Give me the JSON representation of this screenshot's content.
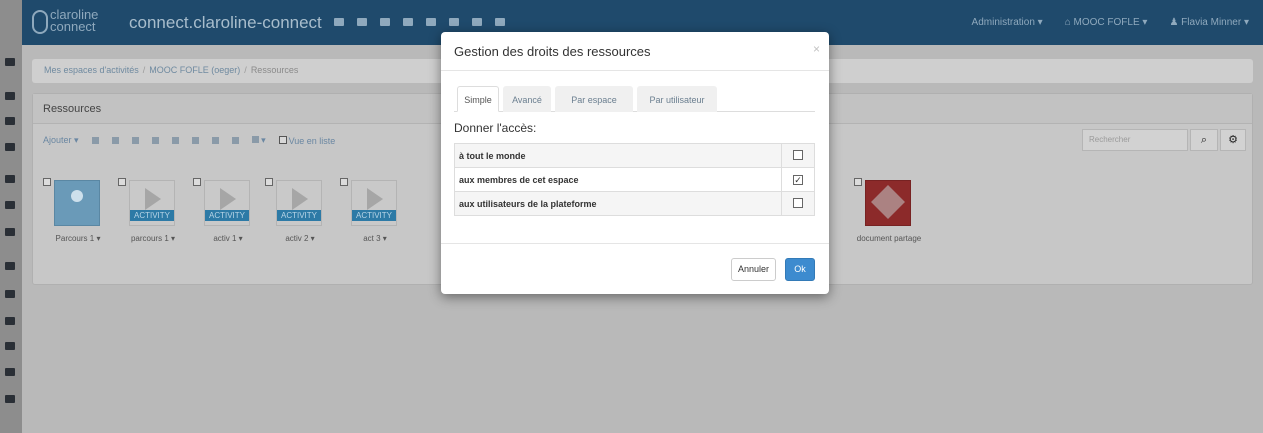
{
  "navbar": {
    "logo_line1": "claroline",
    "logo_line2": "connect",
    "workspace_title": "connect.claroline-connect",
    "admin_menu": "Administration ▾",
    "workspace_menu": "⌂ MOOC FOFLE ▾",
    "user_menu": "♟ Flavia Minner ▾"
  },
  "breadcrumb": {
    "home": "Mes espaces d'activités",
    "workspace": "MOOC FOFLE (oeger)",
    "current": "Ressources"
  },
  "panel": {
    "title": "Ressources",
    "add_label": "Ajouter ▾",
    "view_label": "Vue en liste",
    "search_placeholder": "Rechercher",
    "zoom_label": "▾"
  },
  "resources": [
    {
      "label": "Parcours 1 ▾",
      "type": "path"
    },
    {
      "label": "parcours 1 ▾",
      "type": "activity",
      "band": "ACTIVITY"
    },
    {
      "label": "activ 1 ▾",
      "type": "activity",
      "band": "ACTIVITY"
    },
    {
      "label": "activ 2 ▾",
      "type": "activity",
      "band": "ACTIVITY"
    },
    {
      "label": "act 3 ▾",
      "type": "activity",
      "band": "ACTIVITY"
    },
    {
      "label": "document partage",
      "type": "doc"
    }
  ],
  "modal": {
    "title": "Gestion des droits des ressources",
    "close": "×",
    "tabs": [
      "Simple",
      "Avancé",
      "Par espace",
      "Par utilisateur"
    ],
    "active_tab": "Simple",
    "give_access": "Donner l'accès:",
    "rows": [
      {
        "label": "à tout le monde",
        "checked": false
      },
      {
        "label": "aux membres de cet espace",
        "checked": true
      },
      {
        "label": "aux utilisateurs de la plateforme",
        "checked": false
      }
    ],
    "cancel_label": "Annuler",
    "ok_label": "Ok"
  }
}
